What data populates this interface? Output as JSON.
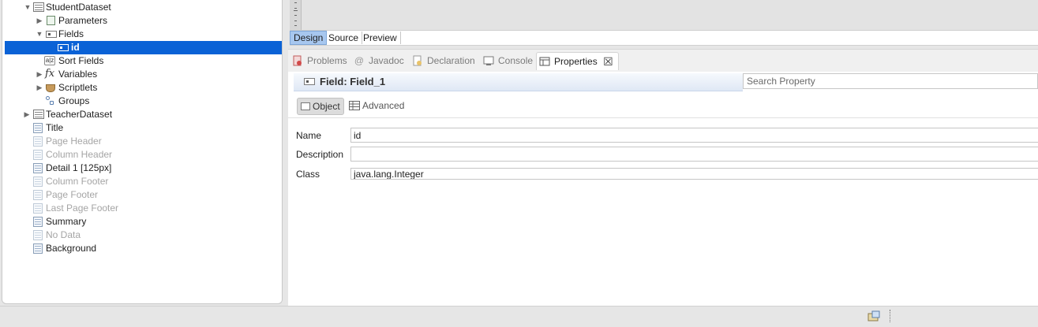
{
  "outline": {
    "items": [
      {
        "label": "StudentDataset",
        "expanded": true,
        "icon": "dataset-icon"
      },
      {
        "label": "Parameters",
        "icon": "parameters-icon"
      },
      {
        "label": "Fields",
        "expanded": true,
        "icon": "fields-icon"
      },
      {
        "label": "id",
        "selected": true,
        "icon": "field-icon"
      },
      {
        "label": "Sort Fields",
        "icon": "sort-fields-icon"
      },
      {
        "label": "Variables",
        "icon": "fx-icon"
      },
      {
        "label": "Scriptlets",
        "icon": "scriptlet-icon"
      },
      {
        "label": "Groups",
        "icon": "groups-icon"
      },
      {
        "label": "TeacherDataset",
        "icon": "dataset-icon"
      },
      {
        "label": "Title",
        "icon": "band-icon"
      },
      {
        "label": "Page Header",
        "disabled": true,
        "icon": "band-icon"
      },
      {
        "label": "Column Header",
        "disabled": true,
        "icon": "band-icon"
      },
      {
        "label": "Detail 1 [125px]",
        "icon": "band-icon"
      },
      {
        "label": "Column Footer",
        "disabled": true,
        "icon": "band-icon"
      },
      {
        "label": "Page Footer",
        "disabled": true,
        "icon": "band-icon"
      },
      {
        "label": "Last Page Footer",
        "disabled": true,
        "icon": "band-icon"
      },
      {
        "label": "Summary",
        "icon": "band-icon"
      },
      {
        "label": "No Data",
        "disabled": true,
        "icon": "band-icon"
      },
      {
        "label": "Background",
        "icon": "band-icon"
      }
    ]
  },
  "editor_tabs": {
    "design": "Design",
    "source": "Source",
    "preview": "Preview",
    "active": "Design"
  },
  "views": {
    "tabs": {
      "problems": "Problems",
      "javadoc": "Javadoc",
      "declaration": "Declaration",
      "console": "Console",
      "properties": "Properties"
    },
    "active": "Properties"
  },
  "properties": {
    "title": "Field: Field_1",
    "search_placeholder": "Search Property",
    "subtabs": {
      "object": "Object",
      "advanced": "Advanced",
      "active": "Object"
    },
    "fields": {
      "name_label": "Name",
      "name_value": "id",
      "description_label": "Description",
      "description_value": "",
      "class_label": "Class",
      "class_value": "java.lang.Integer"
    }
  },
  "colors": {
    "selection": "#0a62d6",
    "active_editor_tab": "#a7c7ef"
  }
}
